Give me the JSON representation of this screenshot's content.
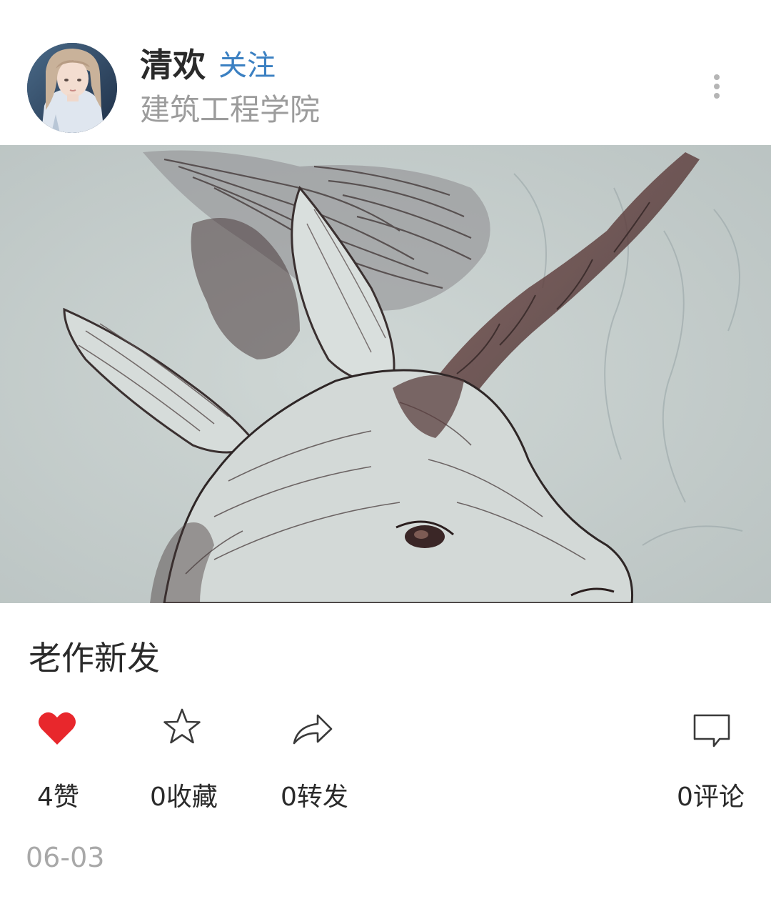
{
  "author": {
    "name": "清欢",
    "follow_label": "关注",
    "school": "建筑工程学院"
  },
  "post": {
    "caption": "老作新发",
    "date": "06-03"
  },
  "actions": {
    "like_label": "4赞",
    "favorite_label": "0收藏",
    "share_label": "0转发",
    "comment_label": "0评论"
  },
  "icons": {
    "menu": "more-vertical-icon",
    "like": "heart-icon",
    "favorite": "star-icon",
    "share": "share-arrow-icon",
    "comment": "speech-bubble-icon"
  },
  "colors": {
    "follow": "#3b80c2",
    "like": "#e8272c",
    "secondary_text": "#9c9c9c"
  }
}
